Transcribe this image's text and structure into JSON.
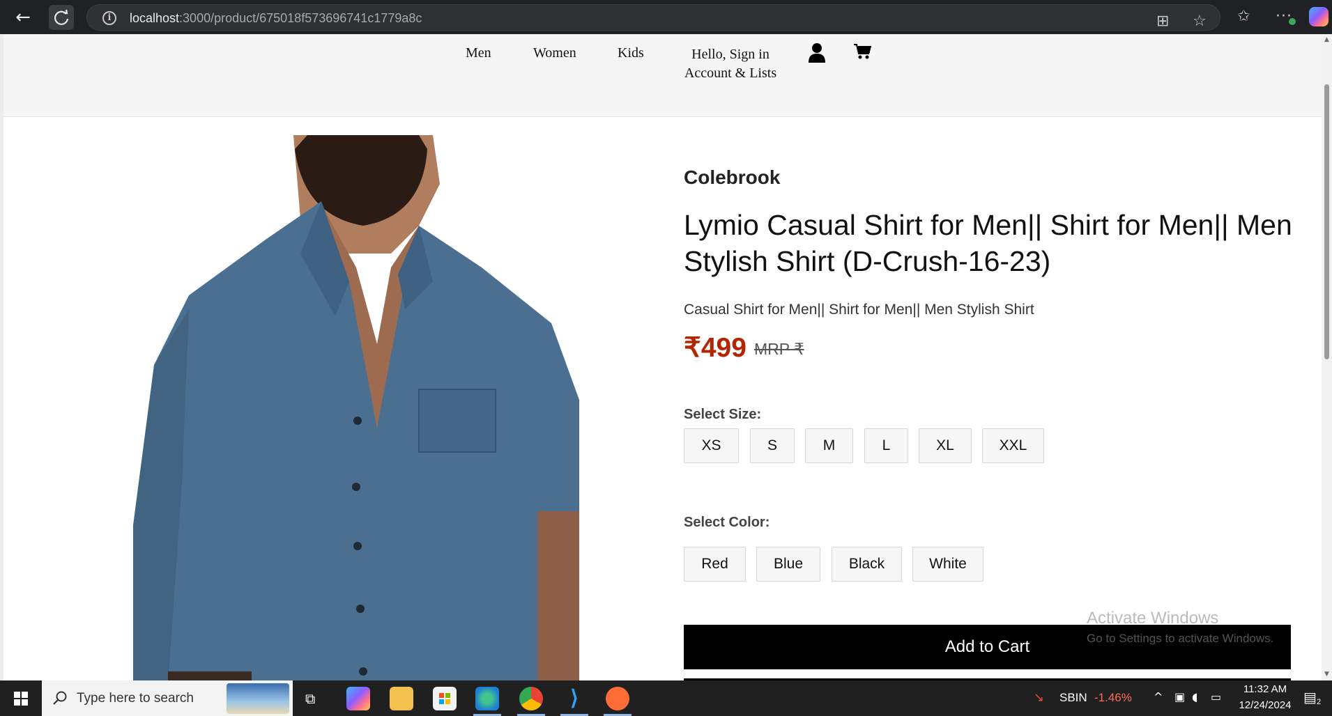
{
  "browser": {
    "url_host": "localhost",
    "url_path": ":3000/product/675018f573696741c1779a8c"
  },
  "header": {
    "nav": [
      "Men",
      "Women",
      "Kids"
    ],
    "account_line1": "Hello, Sign in",
    "account_line2": "Account & Lists"
  },
  "product": {
    "brand": "Colebrook",
    "title": "Lymio Casual Shirt for Men|| Shirt for Men|| Men Stylish Shirt (D-Crush-16-23)",
    "subtitle": "Casual Shirt for Men|| Shirt for Men|| Men Stylish Shirt",
    "price": "₹499",
    "mrp": "MRP ₹",
    "shirt_color": "#4b6f91"
  },
  "size": {
    "label": "Select Size:",
    "options": [
      "XS",
      "S",
      "M",
      "L",
      "XL",
      "XXL"
    ]
  },
  "color": {
    "label": "Select Color:",
    "options": [
      "Red",
      "Blue",
      "Black",
      "White"
    ]
  },
  "cart": {
    "add_label": "Add to Cart"
  },
  "watermark": {
    "title": "Activate Windows",
    "subtitle": "Go to Settings to activate Windows."
  },
  "taskbar": {
    "search_placeholder": "Type here to search",
    "stock_symbol": "SBIN",
    "stock_change": "-1.46%",
    "time": "11:32 AM",
    "date": "12/24/2024",
    "notification_count": "2"
  }
}
